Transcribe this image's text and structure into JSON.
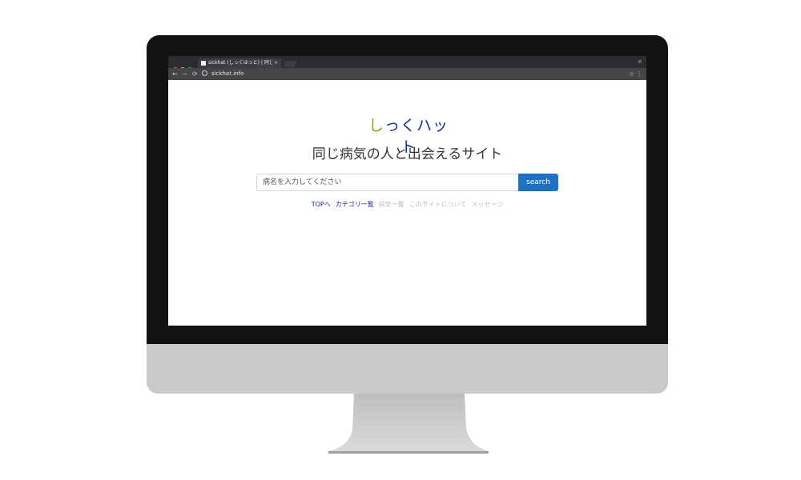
{
  "browser": {
    "tab_title": "sickhat (しっくはっと) | 同じ病気",
    "tab_close": "×",
    "url": "sickhat.info",
    "colors": {
      "traffic_red": "#ff5f57",
      "traffic_yellow": "#febc2e",
      "traffic_green": "#28c840"
    },
    "icons": {
      "back": "←",
      "forward": "→",
      "reload": "⟳",
      "star": "☆",
      "menu": "⋮",
      "profile": "⍝"
    }
  },
  "page": {
    "logo_parts": [
      "し",
      "っくハット"
    ],
    "tagline": "同じ病気の人と出会えるサイト",
    "search": {
      "placeholder": "病名を入力してください",
      "button_label": "search"
    },
    "links": [
      {
        "label": "TOPへ",
        "state": "active"
      },
      {
        "label": "カテゴリ一覧",
        "state": "active"
      },
      {
        "label": "病気一覧",
        "state": "muted"
      },
      {
        "label": "このサイトについて",
        "state": "muted"
      },
      {
        "label": "メッセージ",
        "state": "muted"
      }
    ],
    "colors": {
      "logo": "#1e2d7a",
      "logo_accent": "#8aa12a",
      "button": "#1f72c1",
      "link_active": "#1a2b8c",
      "link_muted": "#bdbdbd"
    }
  }
}
